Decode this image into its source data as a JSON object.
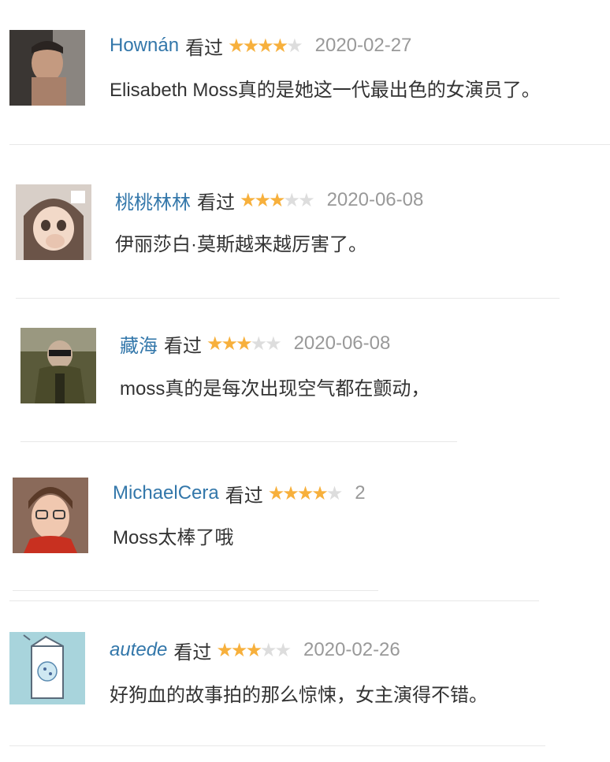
{
  "reviews": [
    {
      "user": "Hownán",
      "status": "看过",
      "rating": 4,
      "date": "2020-02-27",
      "comment": "Elisabeth Moss真的是她这一代最出色的女演员了。"
    },
    {
      "user": "桃桃林林",
      "status": "看过",
      "rating": 3,
      "date": "2020-06-08",
      "comment": "伊丽莎白·莫斯越来越厉害了。"
    },
    {
      "user": "藏海",
      "status": "看过",
      "rating": 3,
      "date": "2020-06-08",
      "comment": "moss真的是每次出现空气都在颤动，"
    },
    {
      "user": "MichaelCera",
      "status": "看过",
      "rating": 4,
      "date": "2",
      "comment": "Moss太棒了哦"
    },
    {
      "user": "autede",
      "status": "看过",
      "rating": 3,
      "date": "2020-02-26",
      "comment": "好狗血的故事拍的那么惊悚，女主演得不错。"
    }
  ],
  "colors": {
    "username": "#3377aa",
    "star_on": "#f7b03c",
    "star_off": "#dddddd",
    "date": "#999999",
    "text": "#333333",
    "divider": "#e8e8e8"
  }
}
